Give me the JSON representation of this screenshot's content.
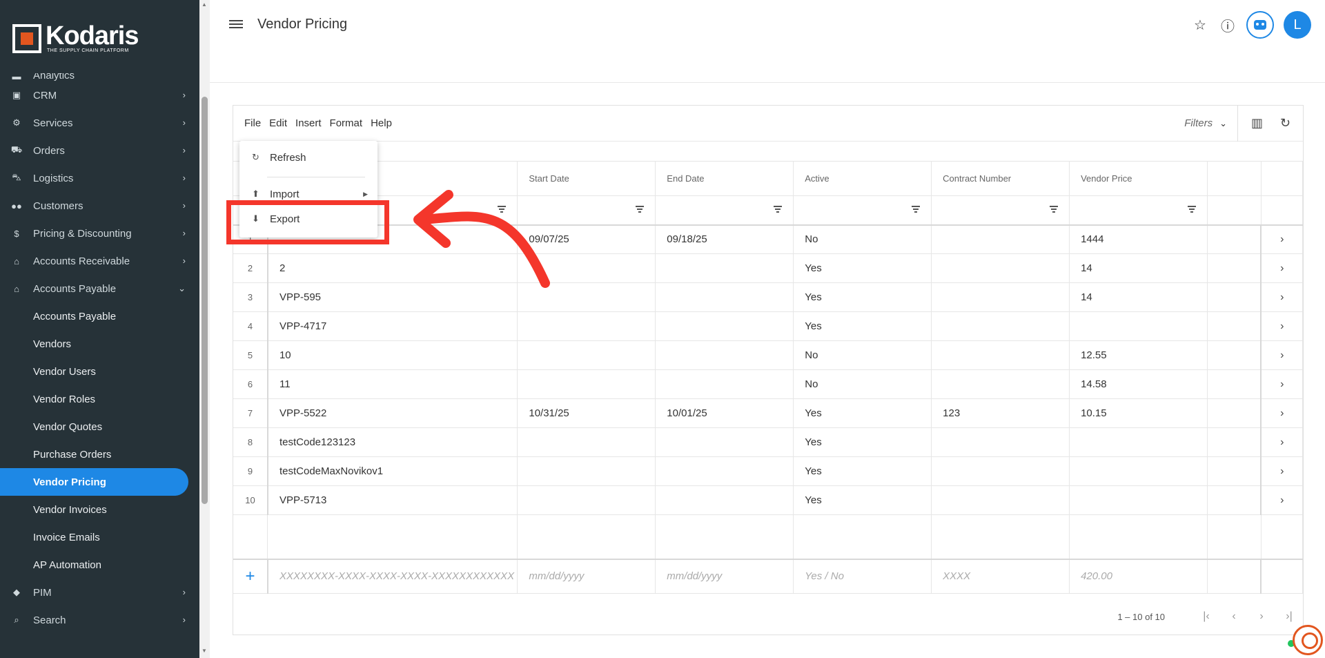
{
  "brand": {
    "name": "Kodaris",
    "tagline": "THE SUPPLY CHAIN PLATFORM",
    "accent": "#1e88e5",
    "logo_color": "#e2561f"
  },
  "sidebar": {
    "partial_top": "Analytics",
    "items": [
      {
        "label": "CRM",
        "icon": "crm-icon"
      },
      {
        "label": "Services",
        "icon": "services-icon"
      },
      {
        "label": "Orders",
        "icon": "orders-icon"
      },
      {
        "label": "Logistics",
        "icon": "logistics-icon"
      },
      {
        "label": "Customers",
        "icon": "customers-icon"
      },
      {
        "label": "Pricing & Discounting",
        "icon": "dollar-icon"
      },
      {
        "label": "Accounts Receivable",
        "icon": "bank-icon"
      },
      {
        "label": "Accounts Payable",
        "icon": "bank-icon"
      }
    ],
    "sub_items": [
      "Accounts Payable",
      "Vendors",
      "Vendor Users",
      "Vendor Roles",
      "Vendor Quotes",
      "Purchase Orders",
      "Vendor Pricing",
      "Vendor Invoices",
      "Invoice Emails",
      "AP Automation"
    ],
    "active_sub": "Vendor Pricing",
    "bottom_items": [
      {
        "label": "PIM",
        "icon": "tag-icon"
      },
      {
        "label": "Search",
        "icon": "search-icon"
      }
    ]
  },
  "header": {
    "title": "Vendor Pricing",
    "avatar_letter": "L"
  },
  "toolbar": {
    "menu": [
      "File",
      "Edit",
      "Insert",
      "Format",
      "Help"
    ],
    "filters_label": "Filters"
  },
  "dropdown": {
    "refresh": "Refresh",
    "import": "Import",
    "export": "Export"
  },
  "grid": {
    "columns": [
      "Start Date",
      "End Date",
      "Active",
      "Contract Number",
      "Vendor Price"
    ],
    "rows": [
      {
        "idx": "1",
        "code": "",
        "start": "09/07/25",
        "end": "09/18/25",
        "active": "No",
        "contract": "",
        "price": "1444"
      },
      {
        "idx": "2",
        "code": "2",
        "start": "",
        "end": "",
        "active": "Yes",
        "contract": "",
        "price": "14"
      },
      {
        "idx": "3",
        "code": "VPP-595",
        "start": "",
        "end": "",
        "active": "Yes",
        "contract": "",
        "price": "14"
      },
      {
        "idx": "4",
        "code": "VPP-4717",
        "start": "",
        "end": "",
        "active": "Yes",
        "contract": "",
        "price": ""
      },
      {
        "idx": "5",
        "code": "10",
        "start": "",
        "end": "",
        "active": "No",
        "contract": "",
        "price": "12.55"
      },
      {
        "idx": "6",
        "code": "11",
        "start": "",
        "end": "",
        "active": "No",
        "contract": "",
        "price": "14.58"
      },
      {
        "idx": "7",
        "code": "VPP-5522",
        "start": "10/31/25",
        "end": "10/01/25",
        "active": "Yes",
        "contract": "123",
        "price": "10.15"
      },
      {
        "idx": "8",
        "code": "testCode123123",
        "start": "",
        "end": "",
        "active": "Yes",
        "contract": "",
        "price": ""
      },
      {
        "idx": "9",
        "code": "testCodeMaxNovikov1",
        "start": "",
        "end": "",
        "active": "Yes",
        "contract": "",
        "price": ""
      },
      {
        "idx": "10",
        "code": "VPP-5713",
        "start": "",
        "end": "",
        "active": "Yes",
        "contract": "",
        "price": ""
      }
    ],
    "new_row": {
      "code": "XXXXXXXX-XXXX-XXXX-XXXX-XXXXXXXXXXXX",
      "start": "mm/dd/yyyy",
      "end": "mm/dd/yyyy",
      "active": "Yes / No",
      "contract": "XXXX",
      "price": "420.00"
    },
    "pagination": "1 – 10 of 10"
  },
  "annotation": {
    "color": "#f4362b"
  }
}
